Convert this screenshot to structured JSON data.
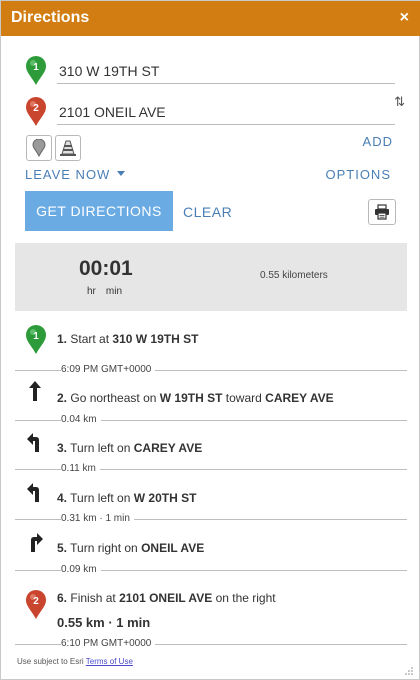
{
  "window": {
    "title": "Directions",
    "close_symbol": "×"
  },
  "stops": [
    {
      "value": "310 W 19TH ST",
      "label": "1",
      "color": "#2e9b3a"
    },
    {
      "value": "2101 ONEIL AVE",
      "label": "2",
      "color": "#c9452e"
    }
  ],
  "swap_symbol": "⇅",
  "actions": {
    "add": "ADD",
    "leave_now": "LEAVE NOW",
    "options": "OPTIONS",
    "get_directions": "GET DIRECTIONS",
    "clear": "CLEAR"
  },
  "summary": {
    "time": "00:01",
    "hr_label": "hr",
    "min_label": "min",
    "distance": "0.55 kilometers"
  },
  "steps": [
    {
      "num": "1.",
      "pre": "Start at",
      "b1": "310 W 19TH ST",
      "mid": "",
      "b2": "",
      "post": "",
      "meta": "6:09 PM GMT+0000",
      "icon": "start-pin-icon"
    },
    {
      "num": "2.",
      "pre": "Go northeast on",
      "b1": "W 19TH ST",
      "mid": "toward",
      "b2": "CAREY AVE",
      "post": "",
      "meta": "0.04 km",
      "icon": "straight-arrow-icon"
    },
    {
      "num": "3.",
      "pre": "Turn left on",
      "b1": "CAREY AVE",
      "mid": "",
      "b2": "",
      "post": "",
      "meta": "0.11 km",
      "icon": "turn-left-icon"
    },
    {
      "num": "4.",
      "pre": "Turn left on",
      "b1": "W 20TH ST",
      "mid": "",
      "b2": "",
      "post": "",
      "meta": "0.31 km · 1 min",
      "icon": "turn-left-icon"
    },
    {
      "num": "5.",
      "pre": "Turn right on",
      "b1": "ONEIL AVE",
      "mid": "",
      "b2": "",
      "post": "",
      "meta": "0.09 km",
      "icon": "turn-right-icon"
    },
    {
      "num": "6.",
      "pre": "Finish at",
      "b1": "2101 ONEIL AVE",
      "mid": "",
      "b2": "",
      "post": " on the right",
      "meta": "6:10 PM GMT+0000",
      "icon": "finish-pin-icon"
    }
  ],
  "finish_summary": "0.55 km · 1 min",
  "footer": {
    "text": "Use subject to Esri",
    "link": "Terms of Use"
  },
  "colors": {
    "title_bar": "#d27d12",
    "accent": "#4a7eb5",
    "button": "#6aabe3",
    "summary_bg": "#e6e6e6"
  }
}
